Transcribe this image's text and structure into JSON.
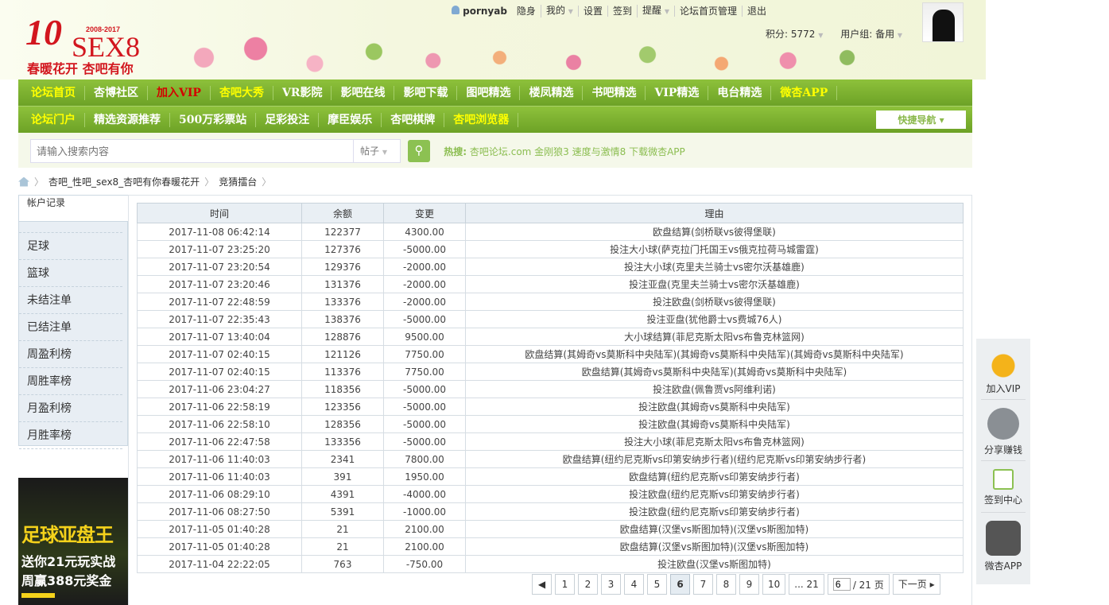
{
  "header": {
    "logo_years": "2008-2017",
    "logo_ten": "10",
    "logo_sex": "SEX8",
    "logo_slogan": "春暖花开 杏吧有你",
    "username": "pornyab",
    "user_links": [
      "隐身",
      "我的",
      "设置",
      "签到",
      "提醒",
      "论坛首页管理",
      "退出"
    ],
    "points": "积分: 5772",
    "user_group": "用户组: 备用"
  },
  "nav1": [
    {
      "label": "论坛首页",
      "color": "yellow"
    },
    {
      "label": "杏博社区"
    },
    {
      "label": "加入VIP",
      "color": "red"
    },
    {
      "label": "杏吧大秀",
      "color": "yellow"
    },
    {
      "label": "VR影院"
    },
    {
      "label": "影吧在线"
    },
    {
      "label": "影吧下载"
    },
    {
      "label": "图吧精选"
    },
    {
      "label": "楼凤精选"
    },
    {
      "label": "书吧精选"
    },
    {
      "label": "VIP精选"
    },
    {
      "label": "电台精选"
    },
    {
      "label": "微杏APP",
      "color": "yellow"
    }
  ],
  "nav2": [
    {
      "label": "论坛门户",
      "color": "yellow"
    },
    {
      "label": "精选资源推荐"
    },
    {
      "label": "500万彩票站"
    },
    {
      "label": "足彩投注"
    },
    {
      "label": "摩臣娱乐"
    },
    {
      "label": "杏吧棋牌"
    },
    {
      "label": "杏吧浏览器",
      "color": "yellow"
    }
  ],
  "quick_nav": "快捷导航 ▾",
  "search": {
    "placeholder": "请输入搜索内容",
    "type": "帖子",
    "hot_label": "热搜:",
    "hot_text": "杏吧论坛.com 金刚狼3 速度与激情8 下载微杏APP"
  },
  "breadcrumb": [
    "杏吧_性吧_sex8_杏吧有你春暖花开",
    "竞猜擂台"
  ],
  "sidebar": {
    "title": "竞猜擂台",
    "items": [
      "足球",
      "篮球",
      "未结注单",
      "已结注单",
      "周盈利榜",
      "周胜率榜",
      "月盈利榜",
      "月胜率榜"
    ],
    "current": "帐户记录"
  },
  "ad": {
    "line1": "足球亚盘王",
    "line2": "送你21元玩实战",
    "line3": "周赢388元奖金"
  },
  "table": {
    "headers": [
      "时间",
      "余额",
      "变更",
      "理由"
    ],
    "rows": [
      [
        "2017-11-08 06:42:14",
        "122377",
        "4300.00",
        "欧盘结算(剑桥联vs彼得堡联)"
      ],
      [
        "2017-11-07 23:25:20",
        "127376",
        "-5000.00",
        "投注大小球(萨克拉门托国王vs俄克拉荷马城雷霆)"
      ],
      [
        "2017-11-07 23:20:54",
        "129376",
        "-2000.00",
        "投注大小球(克里夫兰骑士vs密尔沃基雄鹿)"
      ],
      [
        "2017-11-07 23:20:46",
        "131376",
        "-2000.00",
        "投注亚盘(克里夫兰骑士vs密尔沃基雄鹿)"
      ],
      [
        "2017-11-07 22:48:59",
        "133376",
        "-2000.00",
        "投注欧盘(剑桥联vs彼得堡联)"
      ],
      [
        "2017-11-07 22:35:43",
        "138376",
        "-5000.00",
        "投注亚盘(犹他爵士vs费城76人)"
      ],
      [
        "2017-11-07 13:40:04",
        "128876",
        "9500.00",
        "大小球结算(菲尼克斯太阳vs布鲁克林篮网)"
      ],
      [
        "2017-11-07 02:40:15",
        "121126",
        "7750.00",
        "欧盘结算(其姆奇vs莫斯科中央陆军)(其姆奇vs莫斯科中央陆军)(其姆奇vs莫斯科中央陆军)"
      ],
      [
        "2017-11-07 02:40:15",
        "113376",
        "7750.00",
        "欧盘结算(其姆奇vs莫斯科中央陆军)(其姆奇vs莫斯科中央陆军)"
      ],
      [
        "2017-11-06 23:04:27",
        "118356",
        "-5000.00",
        "投注欧盘(佩鲁贾vs阿维利诺)"
      ],
      [
        "2017-11-06 22:58:19",
        "123356",
        "-5000.00",
        "投注欧盘(其姆奇vs莫斯科中央陆军)"
      ],
      [
        "2017-11-06 22:58:10",
        "128356",
        "-5000.00",
        "投注欧盘(其姆奇vs莫斯科中央陆军)"
      ],
      [
        "2017-11-06 22:47:58",
        "133356",
        "-5000.00",
        "投注大小球(菲尼克斯太阳vs布鲁克林篮网)"
      ],
      [
        "2017-11-06 11:40:03",
        "2341",
        "7800.00",
        "欧盘结算(纽约尼克斯vs印第安纳步行者)(纽约尼克斯vs印第安纳步行者)"
      ],
      [
        "2017-11-06 11:40:03",
        "391",
        "1950.00",
        "欧盘结算(纽约尼克斯vs印第安纳步行者)"
      ],
      [
        "2017-11-06 08:29:10",
        "4391",
        "-4000.00",
        "投注欧盘(纽约尼克斯vs印第安纳步行者)"
      ],
      [
        "2017-11-06 08:27:50",
        "5391",
        "-1000.00",
        "投注欧盘(纽约尼克斯vs印第安纳步行者)"
      ],
      [
        "2017-11-05 01:40:28",
        "21",
        "2100.00",
        "欧盘结算(汉堡vs斯图加特)(汉堡vs斯图加特)"
      ],
      [
        "2017-11-05 01:40:28",
        "21",
        "2100.00",
        "欧盘结算(汉堡vs斯图加特)(汉堡vs斯图加特)"
      ],
      [
        "2017-11-04 22:22:05",
        "763",
        "-750.00",
        "投注欧盘(汉堡vs斯图加特)"
      ]
    ]
  },
  "pager": {
    "prev": "◀",
    "pages": [
      "1",
      "2",
      "3",
      "4",
      "5",
      "6",
      "7",
      "8",
      "9",
      "10",
      "... 21"
    ],
    "current": "6",
    "input_value": "6",
    "total": "/ 21 页",
    "next": "下一页 ▸"
  },
  "float": [
    "加入VIP",
    "分享赚钱",
    "签到中心",
    "微杏APP"
  ]
}
